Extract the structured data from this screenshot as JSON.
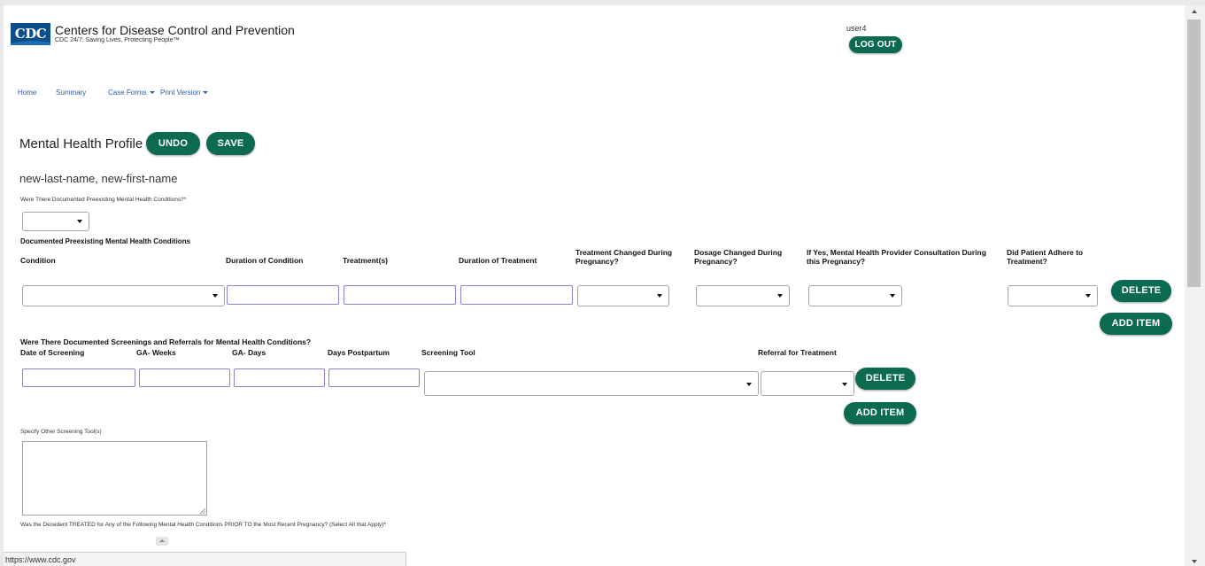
{
  "header": {
    "logo_text": "CDC",
    "org_name": "Centers for Disease Control and Prevention",
    "tagline": "CDC 24/7: Saving Lives, Protecting People™",
    "user": "user4",
    "logout_label": "LOG OUT"
  },
  "nav": {
    "home": "Home",
    "summary": "Summary",
    "case_forms": "Case Forms",
    "print_version": "Print Version"
  },
  "form": {
    "title": "Mental Health Profile",
    "undo_label": "UNDO",
    "save_label": "SAVE",
    "decedent_name": "new-last-name, new-first-name",
    "q_preexisting": "Were There Documented Preexisting Mental Health Conditions?*",
    "preexisting_section": "Documented Preexisting Mental Health Conditions",
    "conditions_columns": [
      "Condition",
      "Duration of Condition",
      "Treatment(s)",
      "Duration of Treatment",
      "Treatment Changed During Pregnancy?",
      "Dosage Changed During Pregnancy?",
      "If Yes, Mental Health Provider Consultation During this Pregnancy?",
      "Did Patient Adhere to Treatment?"
    ],
    "delete_label": "DELETE",
    "add_item_label": "ADD ITEM",
    "screenings_section": "Were There Documented Screenings and Referrals for Mental Health Conditions?",
    "screening_columns": [
      "Date of Screening",
      "GA- Weeks",
      "GA- Days",
      "Days Postpartum",
      "Screening Tool",
      "Referral for Treatment"
    ],
    "q_other_tool": "Specify Other Screening Tool(s)",
    "q_treated_prior": "Was the Decedent TREATED for Any of the Following Mental Health Conditions PRIOR TO the Most Recent Pregnancy? (Select All that Apply)*"
  },
  "status_bar": {
    "url": "https://www.cdc.gov"
  },
  "colors": {
    "button": "#0b6a4f",
    "logo": "#0b4e8a",
    "link": "#2a5db0",
    "input_border": "#8e80d6"
  }
}
